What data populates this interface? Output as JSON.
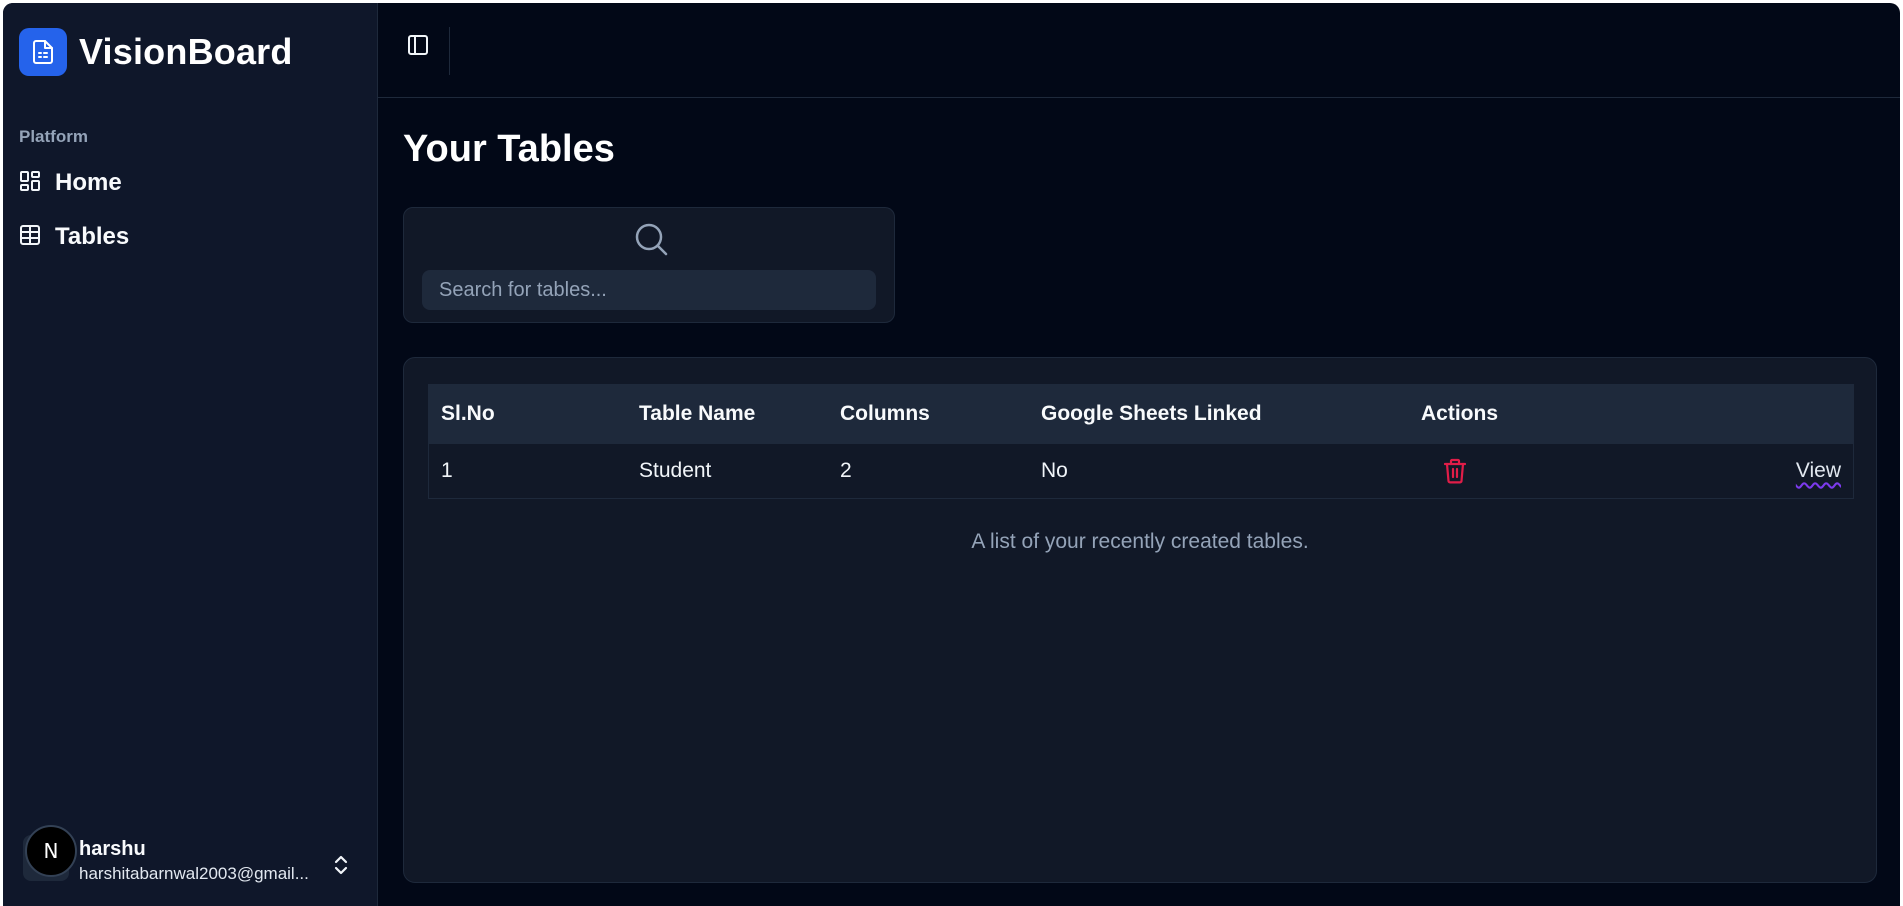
{
  "app": {
    "name": "VisionBoard"
  },
  "sidebar": {
    "section_label": "Platform",
    "items": [
      {
        "label": "Home",
        "icon": "dashboard-grid-icon"
      },
      {
        "label": "Tables",
        "icon": "table-icon"
      }
    ],
    "user": {
      "name": "harshu",
      "email": "harshitabarnwal2003@gmail...",
      "avatar_letter": "N"
    }
  },
  "main": {
    "title": "Your Tables",
    "search": {
      "placeholder": "Search for tables..."
    },
    "table": {
      "headers": [
        "Sl.No",
        "Table Name",
        "Columns",
        "Google Sheets Linked",
        "Actions"
      ],
      "rows": [
        {
          "sl_no": "1",
          "table_name": "Student",
          "columns": "2",
          "google_sheets_linked": "No",
          "view_label": "View"
        }
      ],
      "caption": "A list of your recently created tables."
    }
  },
  "colors": {
    "brand": "#2563eb",
    "background": "#020817",
    "sidebar": "#0f172a",
    "danger": "#e11d48",
    "link_underline": "#7c3aed"
  }
}
